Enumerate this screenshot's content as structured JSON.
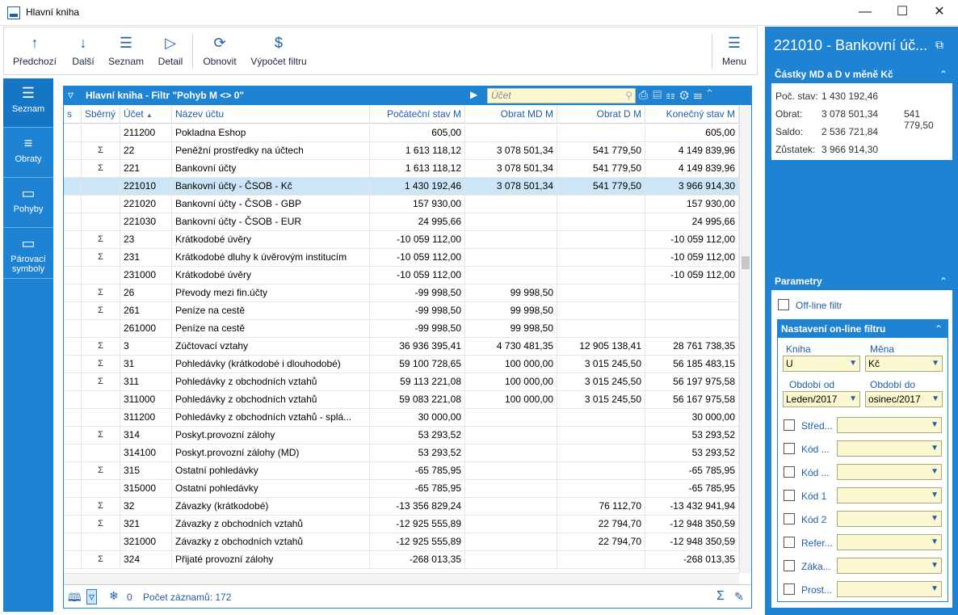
{
  "window": {
    "title": "Hlavní kniha"
  },
  "toolbar": {
    "items": [
      {
        "label": "Předchozí",
        "icon": "↑"
      },
      {
        "label": "Další",
        "icon": "↓"
      },
      {
        "label": "Seznam",
        "icon": "☰"
      },
      {
        "label": "Detail",
        "icon": "▷"
      },
      {
        "label": "Obnovit",
        "icon": "⟳"
      },
      {
        "label": "Výpočet filtru",
        "icon": "$"
      },
      {
        "label": "Menu",
        "icon": "☰"
      }
    ]
  },
  "leftnav": [
    {
      "label": "Seznam",
      "icon": "☰"
    },
    {
      "label": "Obraty",
      "icon": "≡"
    },
    {
      "label": "Pohyby",
      "icon": "▭"
    },
    {
      "label": "Párovací symboly",
      "icon": "▭"
    }
  ],
  "grid": {
    "title": "Hlavní kniha - Filtr \"Pohyb M <> 0\"",
    "search_placeholder": "Účet",
    "columns": [
      "s",
      "Sběrný",
      "Účet",
      "Název účtu",
      "Počáteční stav M",
      "Obrat MD M",
      "Obrat D M",
      "Konečný stav M"
    ],
    "sort_indicator": "▲",
    "rows": [
      {
        "s": "",
        "sb": "",
        "ucet": "211200",
        "nazev": "Pokladna Eshop",
        "poc": "605,00",
        "md": "",
        "d": "",
        "kon": "605,00"
      },
      {
        "s": "",
        "sb": "Σ",
        "ucet": "22",
        "nazev": "Peněžní prostředky na účtech",
        "poc": "1 613 118,12",
        "md": "3 078 501,34",
        "d": "541 779,50",
        "kon": "4 149 839,96"
      },
      {
        "s": "",
        "sb": "Σ",
        "ucet": "221",
        "nazev": "Bankovní účty",
        "poc": "1 613 118,12",
        "md": "3 078 501,34",
        "d": "541 779,50",
        "kon": "4 149 839,96"
      },
      {
        "s": "",
        "sb": "",
        "ucet": "221010",
        "nazev": "Bankovní účty - ČSOB - Kč",
        "poc": "1 430 192,46",
        "md": "3 078 501,34",
        "d": "541 779,50",
        "kon": "3 966 914,30",
        "sel": true
      },
      {
        "s": "",
        "sb": "",
        "ucet": "221020",
        "nazev": "Bankovní účty - ČSOB - GBP",
        "poc": "157 930,00",
        "md": "",
        "d": "",
        "kon": "157 930,00"
      },
      {
        "s": "",
        "sb": "",
        "ucet": "221030",
        "nazev": "Bankovní účty - ČSOB - EUR",
        "poc": "24 995,66",
        "md": "",
        "d": "",
        "kon": "24 995,66"
      },
      {
        "s": "",
        "sb": "Σ",
        "ucet": "23",
        "nazev": "Krátkodobé úvěry",
        "poc": "-10 059 112,00",
        "md": "",
        "d": "",
        "kon": "-10 059 112,00"
      },
      {
        "s": "",
        "sb": "Σ",
        "ucet": "231",
        "nazev": "Krátkodobé dluhy k úvěrovým institucím",
        "poc": "-10 059 112,00",
        "md": "",
        "d": "",
        "kon": "-10 059 112,00"
      },
      {
        "s": "",
        "sb": "",
        "ucet": "231000",
        "nazev": "Krátkodobé úvěry",
        "poc": "-10 059 112,00",
        "md": "",
        "d": "",
        "kon": "-10 059 112,00"
      },
      {
        "s": "",
        "sb": "Σ",
        "ucet": "26",
        "nazev": "Převody mezi fin.účty",
        "poc": "-99 998,50",
        "md": "99 998,50",
        "d": "",
        "kon": ""
      },
      {
        "s": "",
        "sb": "Σ",
        "ucet": "261",
        "nazev": "Peníze na cestě",
        "poc": "-99 998,50",
        "md": "99 998,50",
        "d": "",
        "kon": ""
      },
      {
        "s": "",
        "sb": "",
        "ucet": "261000",
        "nazev": "Peníze na cestě",
        "poc": "-99 998,50",
        "md": "99 998,50",
        "d": "",
        "kon": ""
      },
      {
        "s": "",
        "sb": "Σ",
        "ucet": "3",
        "nazev": "Zúčtovací vztahy",
        "poc": "36 936 395,41",
        "md": "4 730 481,35",
        "d": "12 905 138,41",
        "kon": "28 761 738,35"
      },
      {
        "s": "",
        "sb": "Σ",
        "ucet": "31",
        "nazev": "Pohledávky (krátkodobé i dlouhodobé)",
        "poc": "59 100 728,65",
        "md": "100 000,00",
        "d": "3 015 245,50",
        "kon": "56 185 483,15"
      },
      {
        "s": "",
        "sb": "Σ",
        "ucet": "311",
        "nazev": "Pohledávky z obchodních vztahů",
        "poc": "59 113 221,08",
        "md": "100 000,00",
        "d": "3 015 245,50",
        "kon": "56 197 975,58"
      },
      {
        "s": "",
        "sb": "",
        "ucet": "311000",
        "nazev": "Pohledávky z obchodních vztahů",
        "poc": "59 083 221,08",
        "md": "100 000,00",
        "d": "3 015 245,50",
        "kon": "56 167 975,58"
      },
      {
        "s": "",
        "sb": "",
        "ucet": "311200",
        "nazev": "Pohledávky z obchodních vztahů - splá...",
        "poc": "30 000,00",
        "md": "",
        "d": "",
        "kon": "30 000,00"
      },
      {
        "s": "",
        "sb": "Σ",
        "ucet": "314",
        "nazev": "Poskyt.provozní zálohy",
        "poc": "53 293,52",
        "md": "",
        "d": "",
        "kon": "53 293,52"
      },
      {
        "s": "",
        "sb": "",
        "ucet": "314100",
        "nazev": "Poskyt.provozní zálohy (MD)",
        "poc": "53 293,52",
        "md": "",
        "d": "",
        "kon": "53 293,52"
      },
      {
        "s": "",
        "sb": "Σ",
        "ucet": "315",
        "nazev": "Ostatní pohledávky",
        "poc": "-65 785,95",
        "md": "",
        "d": "",
        "kon": "-65 785,95"
      },
      {
        "s": "",
        "sb": "",
        "ucet": "315000",
        "nazev": "Ostatní pohledávky",
        "poc": "-65 785,95",
        "md": "",
        "d": "",
        "kon": "-65 785,95"
      },
      {
        "s": "",
        "sb": "Σ",
        "ucet": "32",
        "nazev": "Závazky (krátkodobé)",
        "poc": "-13 356 829,24",
        "md": "",
        "d": "76 112,70",
        "kon": "-13 432 941,94"
      },
      {
        "s": "",
        "sb": "Σ",
        "ucet": "321",
        "nazev": "Závazky z obchodních vztahů",
        "poc": "-12 925 555,89",
        "md": "",
        "d": "22 794,70",
        "kon": "-12 948 350,59"
      },
      {
        "s": "",
        "sb": "",
        "ucet": "321000",
        "nazev": "Závazky z obchodních vztahů",
        "poc": "-12 925 555,89",
        "md": "",
        "d": "22 794,70",
        "kon": "-12 948 350,59"
      },
      {
        "s": "",
        "sb": "Σ",
        "ucet": "324",
        "nazev": "Přijaté provozní zálohy",
        "poc": "-268 013,35",
        "md": "",
        "d": "",
        "kon": "-268 013,35"
      }
    ],
    "footer": {
      "snow_count": "0",
      "records": "Počet záznamů: 172"
    }
  },
  "right": {
    "title": "221010 - Bankovní úč...",
    "amounts": {
      "header": "Částky MD a D v měně Kč",
      "poc_label": "Poč. stav:",
      "poc": "1 430 192,46",
      "obrat_label": "Obrat:",
      "obrat_md": "3 078 501,34",
      "obrat_d": "541 779,50",
      "saldo_label": "Saldo:",
      "saldo": "2 536 721,84",
      "zustatek_label": "Zůstatek:",
      "zustatek": "3 966 914,30"
    },
    "params": {
      "header": "Parametry",
      "offline": "Off-line filtr",
      "online_header": "Nastavení on-line filtru",
      "kniha_label": "Kniha",
      "kniha": "U",
      "mena_label": "Měna",
      "mena": "Kč",
      "od_label": "Období od",
      "od": "Leden/2017",
      "do_label": "Období do",
      "do": "osinec/2017",
      "fields": [
        "Střed...",
        "Kód ...",
        "Kód ...",
        "Kód 1",
        "Kód 2",
        "Refer...",
        "Záka...",
        "Prost..."
      ]
    }
  }
}
